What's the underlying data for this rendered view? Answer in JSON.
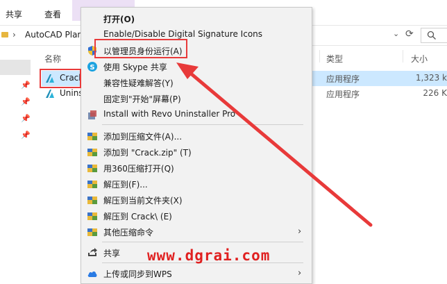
{
  "ribbon": {
    "tabs": [
      "共享",
      "查看"
    ]
  },
  "address": {
    "path": "AutoCAD Plan"
  },
  "columns": {
    "name": "名称",
    "type": "类型",
    "size": "大小"
  },
  "files": [
    {
      "name": "Crack",
      "type": "应用程序",
      "size": "1,323 k"
    },
    {
      "name": "Uninst",
      "type": "应用程序",
      "size": "226 K"
    }
  ],
  "menu": {
    "items": [
      {
        "label": "打开(O)",
        "icon": "none"
      },
      {
        "label": "Enable/Disable Digital Signature Icons",
        "icon": "none"
      },
      {
        "label": "以管理员身份运行(A)",
        "icon": "shield-icon"
      },
      {
        "label": "使用 Skype 共享",
        "icon": "skype-icon"
      },
      {
        "label": "兼容性疑难解答(Y)",
        "icon": "none"
      },
      {
        "label": "固定到\"开始\"屏幕(P)",
        "icon": "none"
      },
      {
        "label": "Install with Revo Uninstaller Pro",
        "icon": "revo-icon"
      },
      {
        "label": "添加到压缩文件(A)...",
        "icon": "archive-icon"
      },
      {
        "label": "添加到 \"Crack.zip\" (T)",
        "icon": "archive-icon"
      },
      {
        "label": "用360压缩打开(Q)",
        "icon": "archive-icon"
      },
      {
        "label": "解压到(F)...",
        "icon": "archive-icon"
      },
      {
        "label": "解压到当前文件夹(X)",
        "icon": "archive-icon"
      },
      {
        "label": "解压到 Crack\\ (E)",
        "icon": "archive-icon"
      },
      {
        "label": "其他压缩命令",
        "icon": "archive-icon"
      },
      {
        "label": "共享",
        "icon": "share-icon"
      },
      {
        "label": "上传或同步到WPS",
        "icon": "wps-cloud-icon"
      }
    ]
  },
  "watermark": "www.dgrai.com",
  "colors": {
    "annotation": "#e83a3a",
    "selection": "#cce8ff",
    "menu_bg": "#f2f2f2"
  }
}
